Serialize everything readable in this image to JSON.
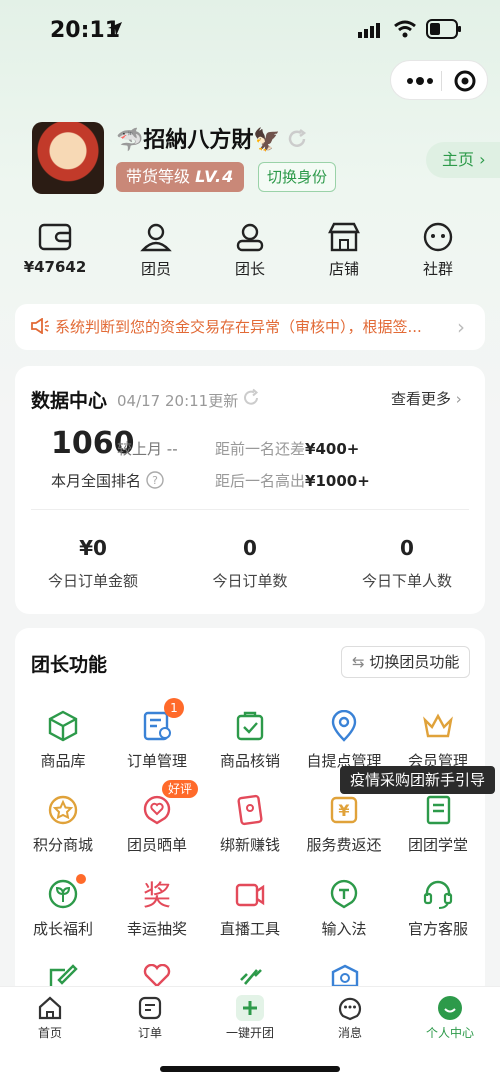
{
  "status": {
    "time": "20:11"
  },
  "profile": {
    "name": "🦈招納八方財🦅",
    "level_label": "带货等级",
    "level_value": "LV.4",
    "switch_role": "切换身份",
    "home": "主页"
  },
  "quick": [
    {
      "value": "¥47642"
    },
    {
      "label": "团员"
    },
    {
      "label": "团长"
    },
    {
      "label": "店铺"
    },
    {
      "label": "社群"
    }
  ],
  "notice": {
    "text": "系统判断到您的资金交易存在异常（审核中），根据签..."
  },
  "data_center": {
    "title": "数据中心",
    "updated": "04/17 20:11更新",
    "more": "查看更多",
    "rank": "1060",
    "compare_label": "较上月",
    "compare_value": "--",
    "rank_label": "本月全国排名",
    "ahead_label": "距前一名还差",
    "ahead_value": "¥400+",
    "behind_label": "距后一名高出",
    "behind_value": "¥1000+",
    "stats": [
      {
        "value": "¥0",
        "label": "今日订单金额"
      },
      {
        "value": "0",
        "label": "今日订单数"
      },
      {
        "value": "0",
        "label": "今日下单人数"
      }
    ]
  },
  "tools": {
    "title": "团长功能",
    "switch": "切换团员功能",
    "tooltip": "疫情采购团新手引导",
    "items": [
      {
        "label": "商品库"
      },
      {
        "label": "订单管理",
        "badge": "1"
      },
      {
        "label": "商品核销"
      },
      {
        "label": "自提点管理"
      },
      {
        "label": "会员管理"
      },
      {
        "label": "积分商城"
      },
      {
        "label": "团员晒单",
        "badge": "好评"
      },
      {
        "label": "绑新赚钱"
      },
      {
        "label": "服务费返还"
      },
      {
        "label": "团团学堂"
      },
      {
        "label": "成长福利"
      },
      {
        "label": "幸运抽奖"
      },
      {
        "label": "直播工具"
      },
      {
        "label": "输入法"
      },
      {
        "label": "官方客服"
      }
    ]
  },
  "tabs": [
    {
      "label": "首页"
    },
    {
      "label": "订单"
    },
    {
      "label": "一键开团"
    },
    {
      "label": "消息"
    },
    {
      "label": "个人中心"
    }
  ],
  "colors": {
    "accent": "#2d9a4a",
    "warning": "#e26a36"
  }
}
